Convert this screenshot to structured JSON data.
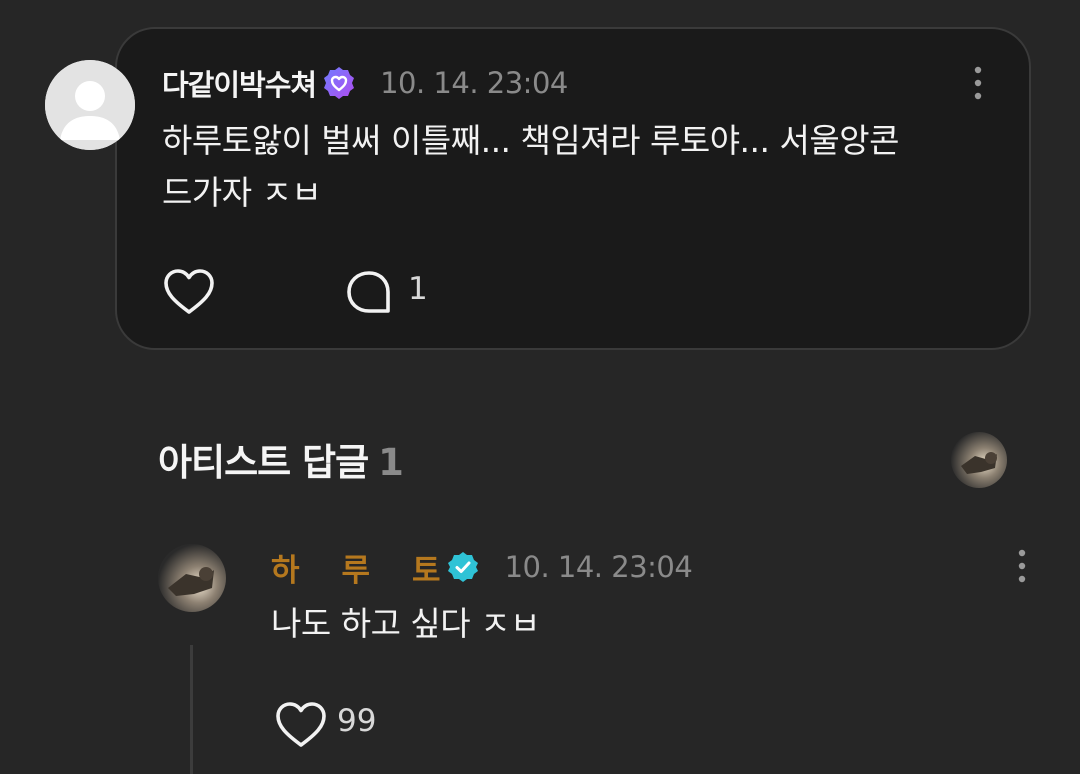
{
  "post": {
    "author": "다같이박수쳐",
    "timestamp": "10. 14. 23:04",
    "body_line1": "하루토앓이 벌써 이틀째...  책임져라 루토야...  서울앙콘",
    "body_line2": "드가자 ㅈㅂ",
    "comment_count": "1",
    "icons": {
      "avatar": "default-user-avatar",
      "badge": "fan-heart-badge-icon",
      "more": "more-vertical-icon",
      "like": "heart-outline-icon",
      "comment": "speech-bubble-icon"
    }
  },
  "artist_replies": {
    "title": "아티스트 답글",
    "count": "1"
  },
  "reply": {
    "author": "하루토",
    "timestamp": "10. 14. 23:04",
    "body": "나도 하고 싶다 ㅈㅂ",
    "like_count": "99",
    "icons": {
      "badge": "verified-check-badge-icon",
      "more": "more-vertical-icon",
      "like": "heart-outline-icon"
    }
  },
  "colors": {
    "background": "#262626",
    "card": "#1a1a1a",
    "artist_name": "#b5781e",
    "muted": "#8a8a8a",
    "verified": "#2fc3d6"
  }
}
